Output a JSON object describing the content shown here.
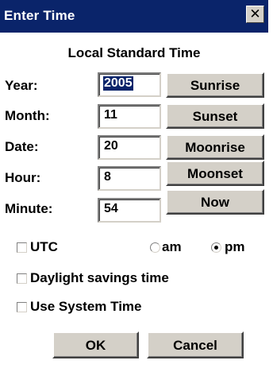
{
  "window": {
    "title": "Enter Time",
    "close_glyph": "✕",
    "close_icon": "close-icon"
  },
  "heading": "Local Standard Time",
  "fields": {
    "year": {
      "label": "Year:",
      "value": "2005",
      "selected": true
    },
    "month": {
      "label": "Month:",
      "value": "11"
    },
    "date": {
      "label": "Date:",
      "value": "20"
    },
    "hour": {
      "label": "Hour:",
      "value": "8"
    },
    "minute": {
      "label": "Minute:",
      "value": "54"
    }
  },
  "side_buttons": {
    "sunrise": "Sunrise",
    "sunset": "Sunset",
    "moonrise": "Moonrise",
    "moonset": "Moonset",
    "now": "Now"
  },
  "options": {
    "utc": {
      "label": "UTC",
      "checked": false
    },
    "am": {
      "label": "am",
      "selected": false
    },
    "pm": {
      "label": "pm",
      "selected": true
    },
    "daylight": {
      "label": "Daylight savings time",
      "checked": false
    },
    "system_time": {
      "label": "Use System Time",
      "checked": false
    }
  },
  "buttons": {
    "ok": "OK",
    "cancel": "Cancel"
  },
  "colors": {
    "titlebar": "#0a246a",
    "face": "#d4d0c8",
    "selection": "#0a246a"
  }
}
